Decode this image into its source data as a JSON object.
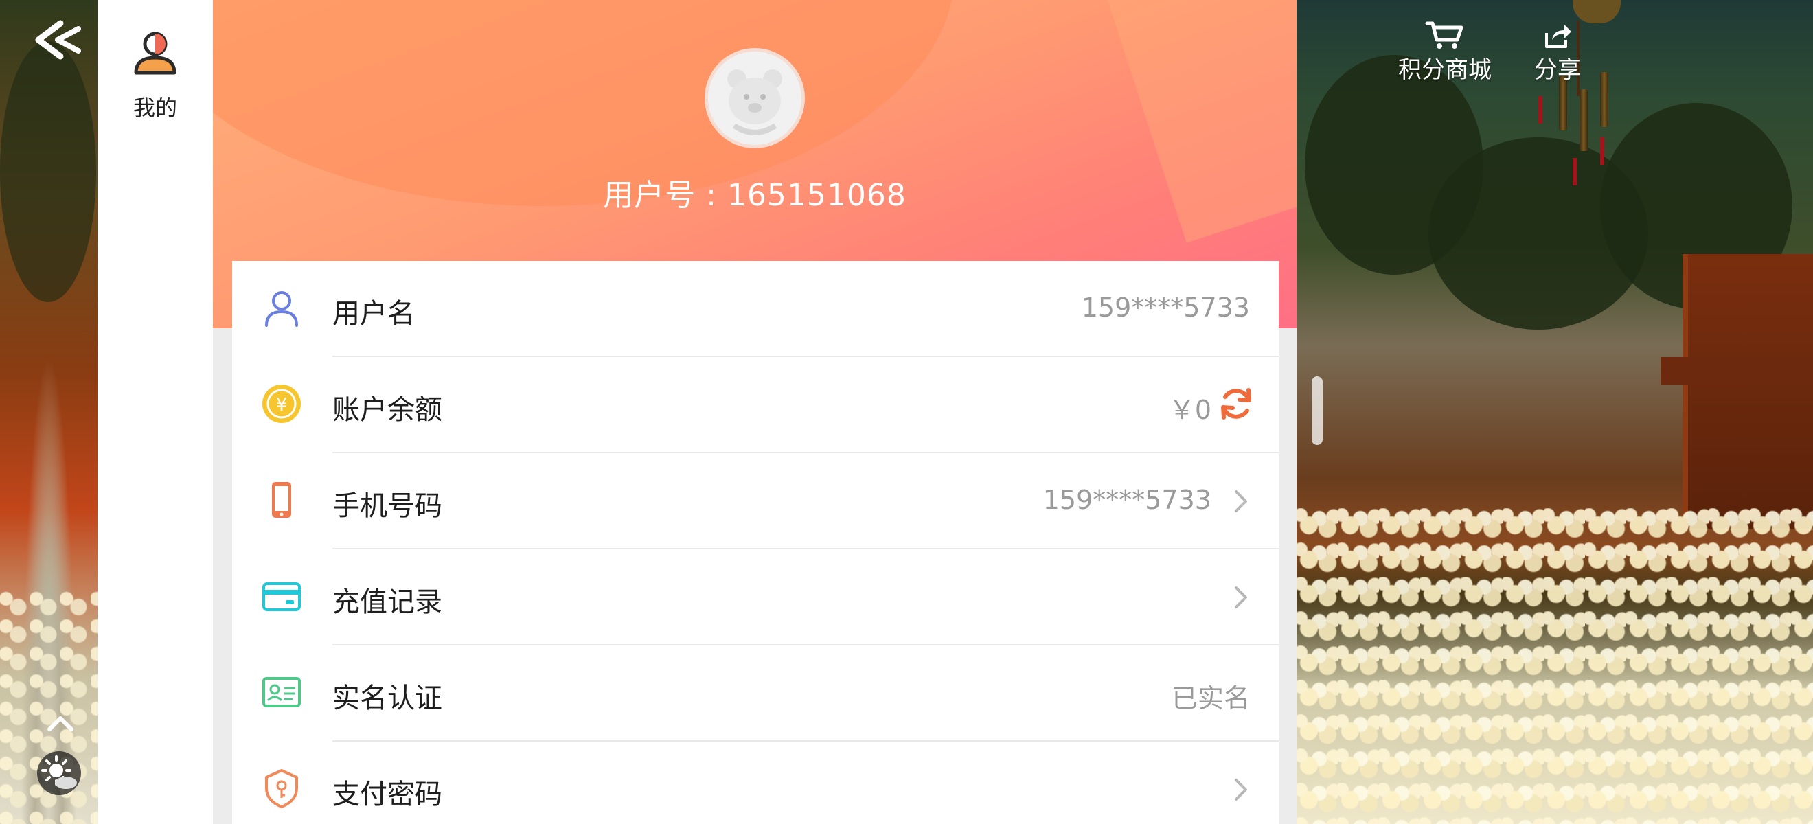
{
  "sidebar": {
    "items": [
      {
        "label": "我的",
        "icon": "person-icon"
      }
    ]
  },
  "header": {
    "user_id": "用户号 : 165151068",
    "avatar": "bear-avatar-icon"
  },
  "rows": [
    {
      "title": "用户名",
      "value": "159****5733",
      "icon": "user-icon",
      "icon_color": "#6b7fe0"
    },
    {
      "title": "账户余额",
      "value": "￥0",
      "icon": "coin-icon",
      "icon_color": "#f5bf2a",
      "action": "refresh-icon",
      "action_color": "#f06b3c"
    },
    {
      "title": "手机号码",
      "value": "159****5733",
      "icon": "phone-icon",
      "icon_color": "#f07a4f",
      "arrow": true
    },
    {
      "title": "充值记录",
      "value": "",
      "icon": "card-icon",
      "icon_color": "#21c8d8",
      "arrow": true
    },
    {
      "title": "实名认证",
      "value": "已实名",
      "icon": "id-card-icon",
      "icon_color": "#4ec98a"
    },
    {
      "title": "支付密码",
      "value": "",
      "icon": "shield-key-icon",
      "icon_color": "#f08a5a",
      "arrow": true
    }
  ],
  "game_ui": {
    "shop_label": "积分商城",
    "share_label": "分享",
    "back_icon": "back-arrow-icon",
    "up_icon": "chevron-up-icon",
    "weather_icon": "sun-cloud-icon"
  },
  "colors": {
    "header_gradient_start": "#ffb07a",
    "header_gradient_end": "#ff6f85",
    "arrow": "#b8b8b8"
  }
}
